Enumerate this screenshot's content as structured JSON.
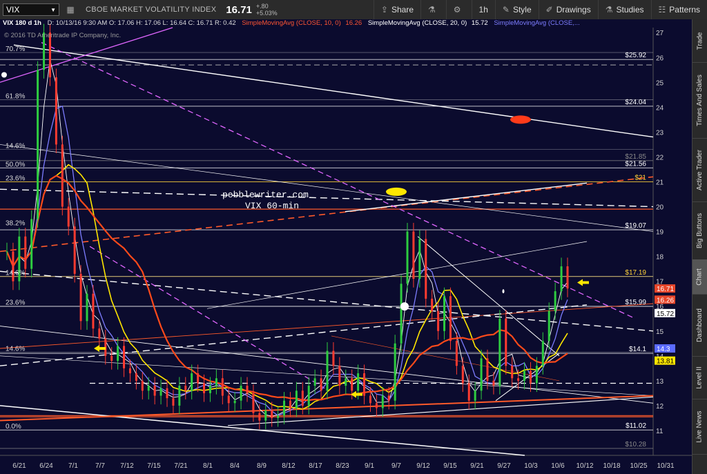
{
  "toolbar": {
    "symbol": "VIX",
    "title": "CBOE MARKET VOLATILITY INDEX",
    "price": "16.71",
    "change": "+.80",
    "change_pct": "+5.03%",
    "buttons": {
      "share": "Share",
      "timeframe": "1h",
      "style": "Style",
      "drawings": "Drawings",
      "studies": "Studies",
      "patterns": "Patterns"
    }
  },
  "infobar": {
    "symbol_period": "VIX 180 d 1h",
    "ohlc": "D: 10/13/16 9:30 AM   O: 17.06   H: 17.06   L: 16.64   C: 16.71   R: 0.42",
    "sma10_label": "SimpleMovingAvg (CLOSE, 10, 0)",
    "sma10_value": "16.26",
    "sma20_label": "SimpleMovingAvg (CLOSE, 20, 0)",
    "sma20_value": "15.72",
    "sma_more_label": "SimpleMovingAvg (CLOSE,..."
  },
  "copyright": "© 2016 TD Ameritrade IP Company, Inc.",
  "annotation": {
    "line1": "pebblewriter.com",
    "line2": "VIX 60-min"
  },
  "fib_left_labels": [
    {
      "label": "70.7%",
      "price": 26.2
    },
    {
      "label": "61.8%",
      "price": 24.3
    },
    {
      "label": "14.6%",
      "price": 22.3
    },
    {
      "label": "50.0%",
      "price": 21.56
    },
    {
      "label": "23.6%",
      "price": 21.0
    },
    {
      "label": "38.2%",
      "price": 19.2
    },
    {
      "label": "14.6%",
      "price": 17.2
    },
    {
      "label": "23.6%",
      "price": 16.0
    },
    {
      "label": "14.6%",
      "price": 14.15
    },
    {
      "label": "0.0%",
      "price": 11.02
    }
  ],
  "level_labels": [
    {
      "text": "$25.92",
      "price": 25.92,
      "color": "#ffffff"
    },
    {
      "text": "$24.04",
      "price": 24.04,
      "color": "#ffffff"
    },
    {
      "text": "$21.85",
      "price": 21.85,
      "color": "#888888"
    },
    {
      "text": "$21.56",
      "price": 21.56,
      "color": "#ffffff"
    },
    {
      "text": "$21",
      "price": 21.0,
      "color": "#ffd23a"
    },
    {
      "text": "$19.07",
      "price": 19.07,
      "color": "#ffffff"
    },
    {
      "text": "$17.19",
      "price": 17.19,
      "color": "#ffd23a"
    },
    {
      "text": "$15.99",
      "price": 15.99,
      "color": "#ffffff"
    },
    {
      "text": "$14.1",
      "price": 14.1,
      "color": "#ffffff"
    },
    {
      "text": "$11.02",
      "price": 11.02,
      "color": "#ffffff"
    },
    {
      "text": "$10.28",
      "price": 10.28,
      "color": "#888888"
    }
  ],
  "price_tags": [
    {
      "text": "16.71",
      "price": 16.71,
      "bg": "#e8472b",
      "fg": "#ffffff"
    },
    {
      "text": "16.26",
      "price": 16.26,
      "bg": "#e8472b",
      "fg": "#ffffff"
    },
    {
      "text": "15.72",
      "price": 15.72,
      "bg": "#ffffff",
      "fg": "#000000"
    },
    {
      "text": "14.3",
      "price": 14.3,
      "bg": "#5b6bff",
      "fg": "#ffffff"
    },
    {
      "text": "13.81",
      "price": 13.81,
      "bg": "#ffe600",
      "fg": "#000000"
    }
  ],
  "y_axis": {
    "min": 10,
    "max": 27.2,
    "ticks": [
      "11",
      "12",
      "13",
      "14",
      "15",
      "16",
      "17",
      "18",
      "19",
      "20",
      "21",
      "22",
      "23",
      "24",
      "25",
      "26",
      "27"
    ]
  },
  "x_axis": {
    "labels": [
      "6/21",
      "6/24",
      "7/1",
      "7/7",
      "7/12",
      "7/15",
      "7/21",
      "8/1",
      "8/4",
      "8/9",
      "8/12",
      "8/17",
      "8/23",
      "9/1",
      "9/7",
      "9/12",
      "9/15",
      "9/21",
      "9/27",
      "10/3",
      "10/6",
      "10/12",
      "10/18",
      "10/25",
      "10/31"
    ]
  },
  "sidebar_tabs": [
    "Trade",
    "Times And Sales",
    "Active Trader",
    "Big Buttons",
    "Chart",
    "Dashboard",
    "Level II",
    "Live News"
  ],
  "active_tab": "Chart",
  "colors": {
    "background": "#0b0b2e",
    "sma10": "#ff5533",
    "sma20": "#ffffff",
    "sma_blue": "#7d7dff",
    "sma_yellow": "#ffe600",
    "sma_orange": "#ff4a1a",
    "fan_magenta": "#e066ff"
  },
  "price_series": [
    18.2,
    17.0,
    18.8,
    17.5,
    19.5,
    25.5,
    27.0,
    25.2,
    22.5,
    20.0,
    19.2,
    17.3,
    15.4,
    16.5,
    15.1,
    14.7,
    14.0,
    13.8,
    14.4,
    13.5,
    13.3,
    13.0,
    12.6,
    12.8,
    12.4,
    12.7,
    12.3,
    12.0,
    12.8,
    12.6,
    13.3,
    12.9,
    12.5,
    12.8,
    13.1,
    12.4,
    12.1,
    12.2,
    12.8,
    12.5,
    11.7,
    11.4,
    11.8,
    11.5,
    11.6,
    12.2,
    11.9,
    12.6,
    12.0,
    12.8,
    13.1,
    12.6,
    14.2,
    13.6,
    12.8,
    13.1,
    12.6,
    13.3,
    12.4,
    12.1,
    11.9,
    12.4,
    12.2,
    14.5,
    16.9,
    19.0,
    17.1,
    18.7,
    16.3,
    15.8,
    15.0,
    16.4,
    14.6,
    13.6,
    12.9,
    12.2,
    12.6,
    13.9,
    13.0,
    12.8,
    15.5,
    13.6,
    13.1,
    13.0,
    13.4,
    12.9,
    13.6,
    14.6,
    15.8,
    16.6,
    17.6,
    16.71
  ]
}
